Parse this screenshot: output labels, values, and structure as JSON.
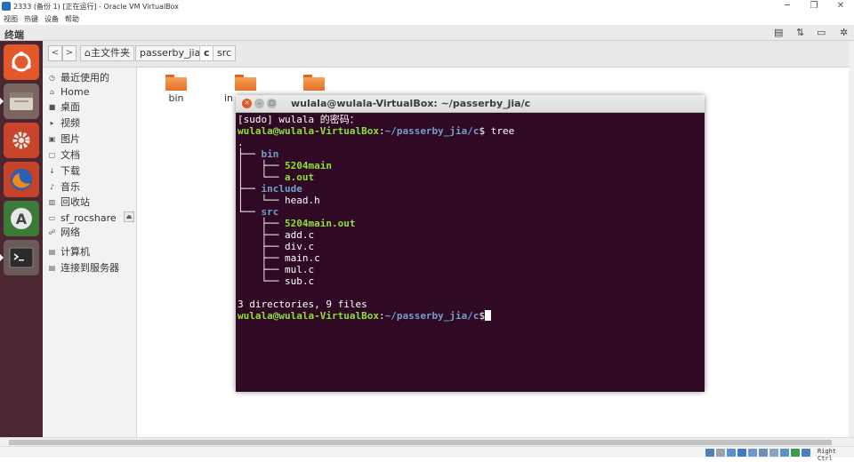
{
  "vbox": {
    "window_title": "2333 (备份 1) [正在运行] - Oracle VM VirtualBox",
    "menu": [
      "视图",
      "热键",
      "设备",
      "帮助"
    ],
    "host_key": "Right Ctrl"
  },
  "ubuntu": {
    "app_name": "终端"
  },
  "file_manager": {
    "back_label": "<",
    "forward_label": ">",
    "breadcrumbs": [
      {
        "label": "⌂主文件夹"
      },
      {
        "label": "passerby_jia"
      },
      {
        "label": "c"
      },
      {
        "label": "src"
      }
    ],
    "sidebar": [
      {
        "icon": "◷",
        "label": "最近使用的"
      },
      {
        "icon": "⌂",
        "label": "Home"
      },
      {
        "icon": "■",
        "label": "桌面"
      },
      {
        "icon": "▸",
        "label": "视频"
      },
      {
        "icon": "▣",
        "label": "图片"
      },
      {
        "icon": "▢",
        "label": "文档"
      },
      {
        "icon": "↓",
        "label": "下载"
      },
      {
        "icon": "♪",
        "label": "音乐"
      },
      {
        "icon": "▥",
        "label": "回收站"
      },
      {
        "icon": "▭",
        "label": "sf_rocshare"
      },
      {
        "icon": "☍",
        "label": "网络"
      },
      {
        "icon": "▤",
        "label": "计算机"
      },
      {
        "icon": "▤",
        "label": "连接到服务器"
      }
    ],
    "eject_label": "⏏",
    "folders": [
      {
        "label": "bin"
      },
      {
        "label": "in"
      },
      {
        "label": ""
      }
    ]
  },
  "terminal": {
    "title": "wulala@wulala-VirtualBox: ~/passerby_jia/c",
    "prompt_user": "wulala@wulala-VirtualBox",
    "prompt_sep": ":",
    "prompt_path": "~/passerby_jia/c",
    "prompt_dollar": "$",
    "sudo_line": "[sudo] wulala 的密码：",
    "command": " tree",
    "tree": [
      {
        "prefix": ".",
        "name": "",
        "kind": "w"
      },
      {
        "prefix": "├── ",
        "name": "bin",
        "kind": "b"
      },
      {
        "prefix": "│   ├── ",
        "name": "5204main",
        "kind": "g"
      },
      {
        "prefix": "│   └── ",
        "name": "a.out",
        "kind": "g"
      },
      {
        "prefix": "├── ",
        "name": "include",
        "kind": "b"
      },
      {
        "prefix": "│   └── ",
        "name": "head.h",
        "kind": "w"
      },
      {
        "prefix": "└── ",
        "name": "src",
        "kind": "b"
      },
      {
        "prefix": "    ├── ",
        "name": "5204main.out",
        "kind": "g"
      },
      {
        "prefix": "    ├── ",
        "name": "add.c",
        "kind": "w"
      },
      {
        "prefix": "    ├── ",
        "name": "div.c",
        "kind": "w"
      },
      {
        "prefix": "    ├── ",
        "name": "main.c",
        "kind": "w"
      },
      {
        "prefix": "    ├── ",
        "name": "mul.c",
        "kind": "w"
      },
      {
        "prefix": "    └── ",
        "name": "sub.c",
        "kind": "w"
      }
    ],
    "summary": "3 directories, 9 files"
  },
  "colors": {
    "terminal_bg": "#300a24",
    "launcher_bg": "#4a2731",
    "prompt_green": "#8ae234",
    "dir_blue": "#729fcf",
    "folder_orange": "#e86f25"
  }
}
